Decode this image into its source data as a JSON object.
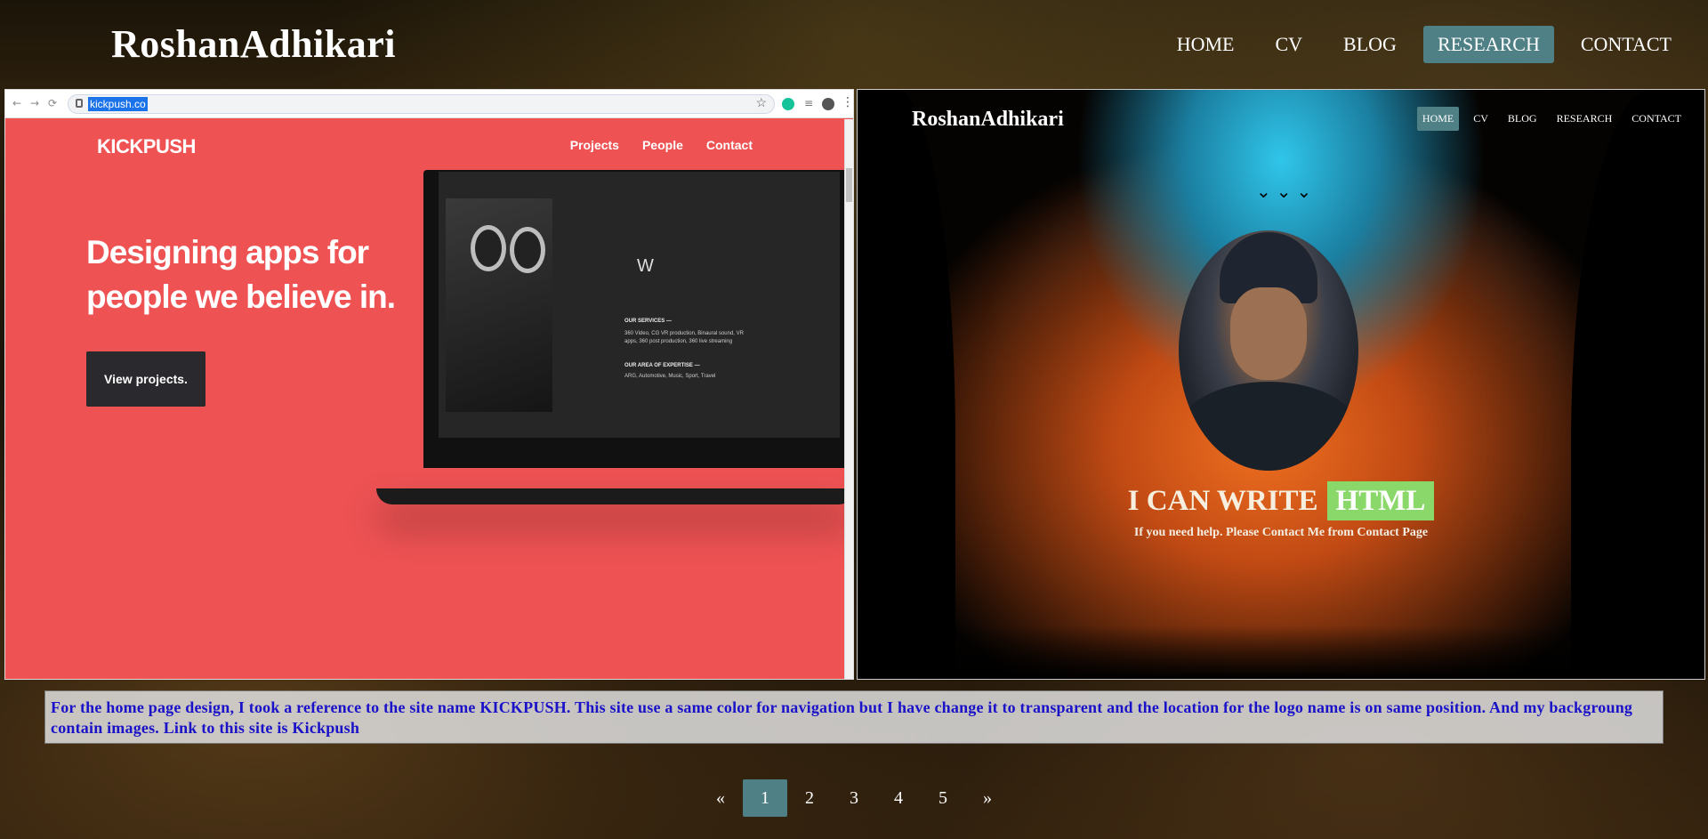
{
  "site": {
    "logo": "RoshanAdhikari",
    "nav": [
      {
        "label": "HOME"
      },
      {
        "label": "CV"
      },
      {
        "label": "BLOG"
      },
      {
        "label": "RESEARCH",
        "active": true
      },
      {
        "label": "CONTACT"
      }
    ]
  },
  "left_screenshot": {
    "browser_url": "kickpush.co",
    "logo": "KICKPUSH",
    "nav": [
      "Projects",
      "People",
      "Contact"
    ],
    "headline": "Designing apps for people we believe in.",
    "button": "View projects.",
    "services_title": "OUR SERVICES —",
    "services_text": "360 Video, CG VR production, Binaural sound, VR apps, 360 post production, 360 live streaming",
    "expertise_title": "OUR AREA OF EXPERTISE —",
    "expertise_text": "ARG, Automotive, Music, Sport, Travel"
  },
  "right_screenshot": {
    "logo": "RoshanAdhikari",
    "nav": [
      {
        "label": "HOME",
        "active": true
      },
      {
        "label": "CV"
      },
      {
        "label": "BLOG"
      },
      {
        "label": "RESEARCH"
      },
      {
        "label": "CONTACT"
      }
    ],
    "write_prefix": "I CAN WRITE",
    "write_highlight": "HTML",
    "subtitle": "If you need help. Please Contact Me from Contact Page"
  },
  "caption": "For the home page design, I took a reference to the site name KICKPUSH. This site use a same color for navigation but I have change it to transparent and the location for the logo name is on same position. And my backgroung contain images. Link to this site is Kickpush",
  "pagination": {
    "prev": "«",
    "pages": [
      "1",
      "2",
      "3",
      "4",
      "5"
    ],
    "current": "1",
    "next": "»"
  },
  "colors": {
    "accent": "#4f8086",
    "kickpush_red": "#ee5253",
    "caption_text": "#1a12c8",
    "highlight_green": "#8bd86a"
  }
}
